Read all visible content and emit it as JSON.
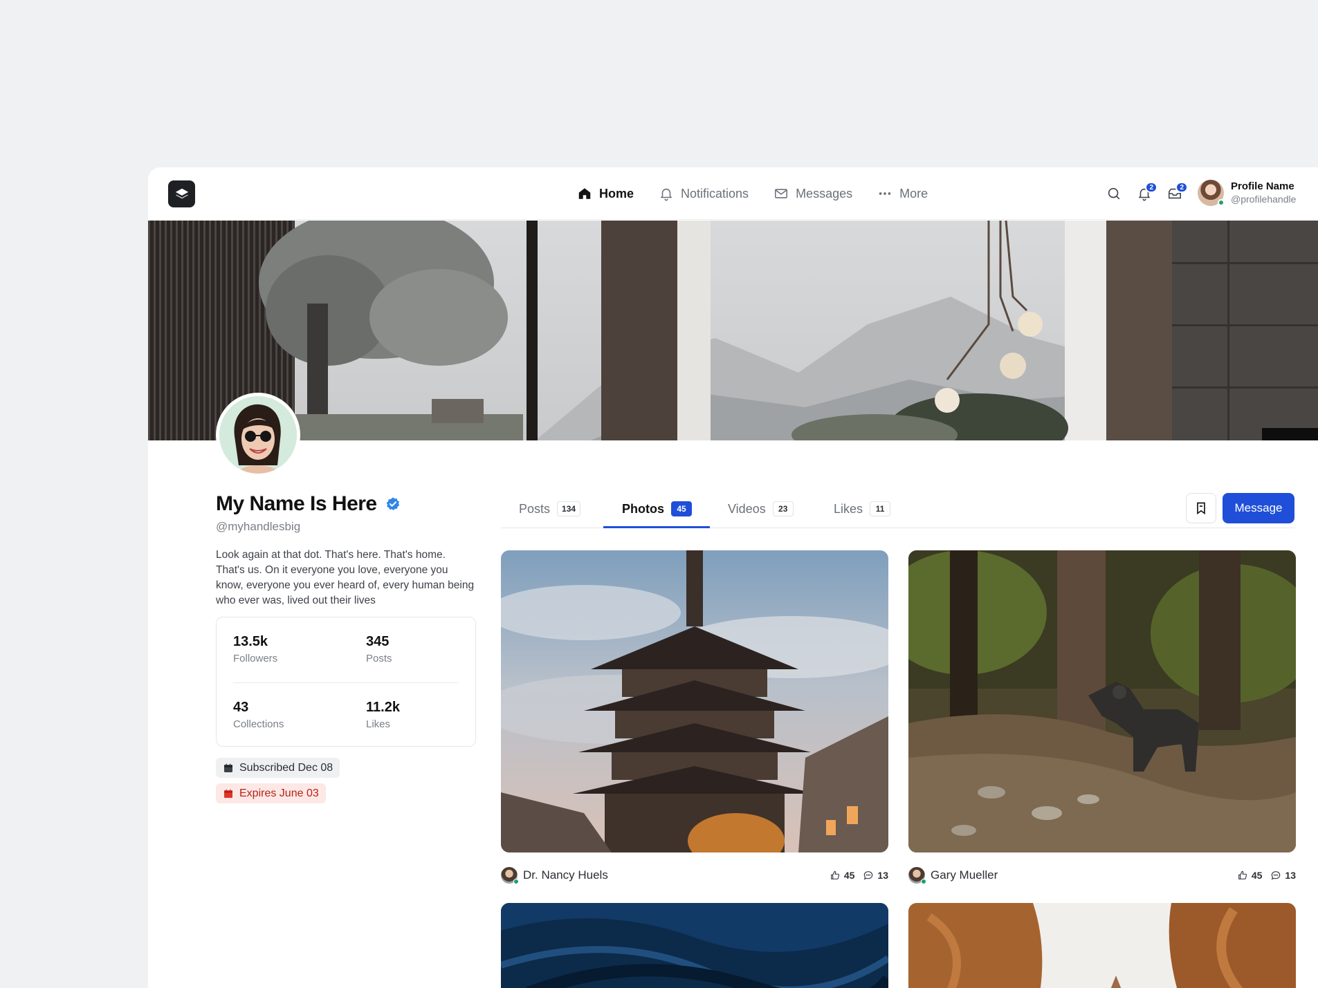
{
  "nav": {
    "links": [
      {
        "label": "Home",
        "icon": "home-icon",
        "active": true
      },
      {
        "label": "Notifications",
        "icon": "bell-icon",
        "active": false
      },
      {
        "label": "Messages",
        "icon": "mail-icon",
        "active": false
      },
      {
        "label": "More",
        "icon": "more-icon",
        "active": false
      }
    ],
    "notifications_badge": "2",
    "inbox_badge": "2",
    "profile_name": "Profile Name",
    "profile_handle": "@profilehandle"
  },
  "profile": {
    "name": "My Name Is Here",
    "handle": "@myhandlesbig",
    "verified": true,
    "bio": "Look again at that dot. That's here. That's home. That's us. On it everyone you love, everyone you know, everyone you ever heard of, every human being who ever was, lived out their lives",
    "stats": [
      {
        "value": "13.5k",
        "label": "Followers"
      },
      {
        "value": "345",
        "label": "Posts"
      },
      {
        "value": "43",
        "label": "Collections"
      },
      {
        "value": "11.2k",
        "label": "Likes"
      }
    ],
    "subscribed": "Subscribed Dec 08",
    "expires": "Expires June 03"
  },
  "tabs": [
    {
      "label": "Posts",
      "count": "134"
    },
    {
      "label": "Photos",
      "count": "45"
    },
    {
      "label": "Videos",
      "count": "23"
    },
    {
      "label": "Likes",
      "count": "11"
    }
  ],
  "active_tab": "Photos",
  "actions": {
    "message_label": "Message"
  },
  "posts": [
    {
      "author": "Dr. Nancy Huels",
      "likes": "45",
      "comments": "13"
    },
    {
      "author": "Gary Mueller",
      "likes": "45",
      "comments": "13"
    }
  ],
  "colors": {
    "accent": "#1f4fd8",
    "verified": "#2f86e8",
    "expires_bg": "#fde8e6",
    "expires_icon": "#e0352b"
  }
}
